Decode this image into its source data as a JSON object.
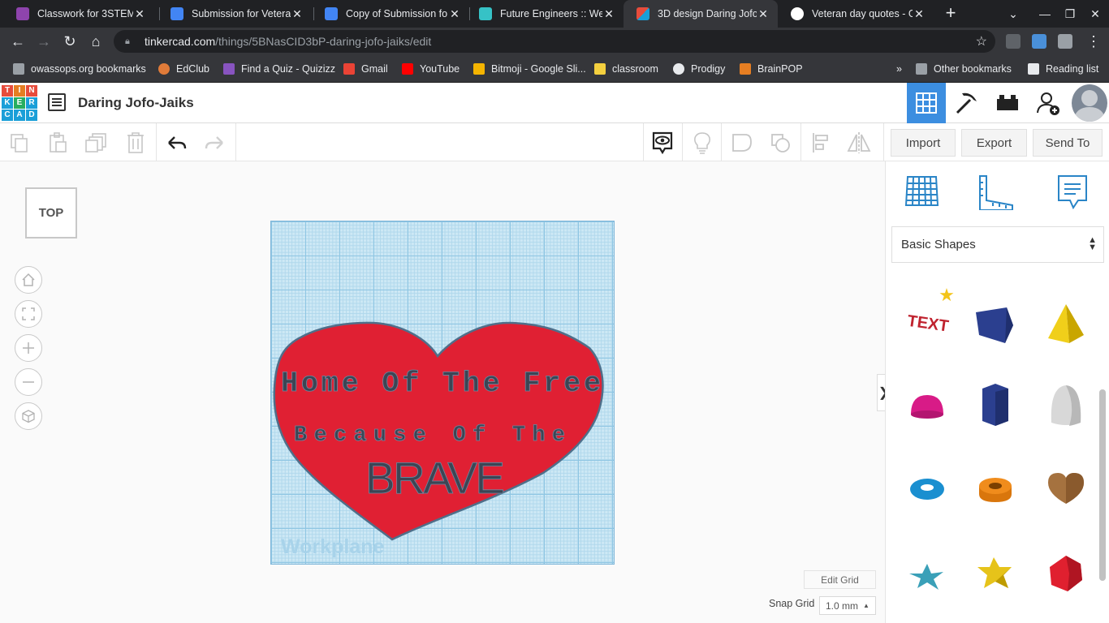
{
  "browser": {
    "tabs": [
      {
        "title": "Classwork for 3STEM/...",
        "color": "#8e44ad"
      },
      {
        "title": "Submission for Veteran",
        "color": "#4285f4"
      },
      {
        "title": "Copy of Submission fo",
        "color": "#4285f4"
      },
      {
        "title": "Future Engineers :: We",
        "color": "#36c2c6"
      },
      {
        "title": "3D design Daring Jofo-",
        "color": "#e74c3c"
      },
      {
        "title": "Veteran day quotes - G",
        "color": "#ffffff"
      }
    ],
    "url_domain": "tinkercad.com",
    "url_path": "/things/5BNasCID3bP-daring-jofo-jaiks/edit",
    "bookmarks": [
      {
        "label": "owassops.org bookmarks",
        "color": "#9aa0a6"
      },
      {
        "label": "EdClub",
        "color": "#e07b39"
      },
      {
        "label": "Find a Quiz - Quizizz",
        "color": "#8854c0"
      },
      {
        "label": "Gmail",
        "color": "#ea4335"
      },
      {
        "label": "YouTube",
        "color": "#ff0000"
      },
      {
        "label": "Bitmoji - Google Sli...",
        "color": "#f4b400"
      },
      {
        "label": "classroom",
        "color": "#f4d03f"
      },
      {
        "label": "Prodigy",
        "color": "#e8eaed"
      },
      {
        "label": "BrainPOP",
        "color": "#e67e22"
      }
    ],
    "other_bookmarks": "Other bookmarks",
    "reading_list": "Reading list",
    "overflow": "»"
  },
  "app": {
    "logo_letters": [
      "T",
      "I",
      "N",
      "K",
      "E",
      "R",
      "C",
      "A",
      "D"
    ],
    "logo_colors": [
      "#e74c3c",
      "#e67e22",
      "#e74c3c",
      "#1a9fd8",
      "#27ae60",
      "#1a9fd8",
      "#1a9fd8",
      "#1a9fd8",
      "#1a9fd8"
    ],
    "design_title": "Daring Jofo-Jaiks",
    "import_label": "Import",
    "export_label": "Export",
    "send_to_label": "Send To",
    "viewcube_label": "TOP",
    "workplane_label": "Workplane",
    "heart_text": {
      "line1": "Home Of The Free",
      "line2": "Because  Of   The",
      "line3": "BRAVE"
    },
    "edit_grid_label": "Edit Grid",
    "snap_grid_label": "Snap Grid",
    "snap_grid_value": "1.0 mm",
    "collapse_icon": "❯",
    "shapes_category": "Basic Shapes",
    "accent": "#3c8ee0",
    "heart_color": "#e02033"
  }
}
